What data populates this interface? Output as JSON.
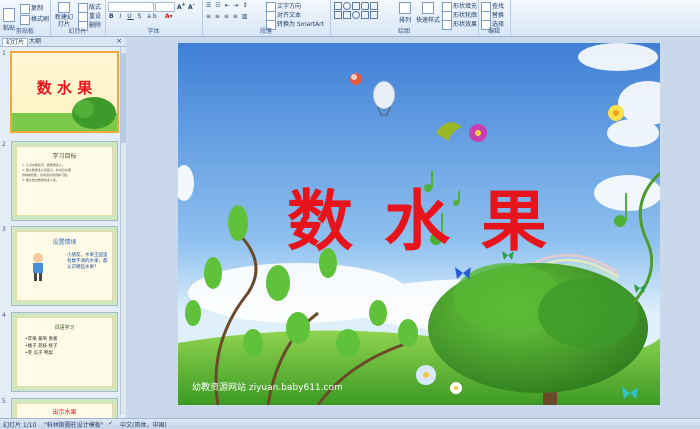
{
  "ribbon": {
    "groups": [
      {
        "label": "剪贴板",
        "buttons": [
          "粘贴",
          "复制",
          "格式刷"
        ]
      },
      {
        "label": "幻灯片",
        "buttons": [
          "新建幻灯片",
          "版式",
          "重设",
          "删除"
        ]
      },
      {
        "label": "字体",
        "buttons": []
      },
      {
        "label": "段落",
        "buttons": [
          "文字方向",
          "对齐文本",
          "转换为 SmartArt"
        ]
      },
      {
        "label": "绘图",
        "buttons": [
          "排列",
          "快速样式",
          "形状填充",
          "形状轮廓",
          "形状效果"
        ]
      },
      {
        "label": "编辑",
        "buttons": [
          "查找",
          "替换",
          "选择"
        ]
      }
    ]
  },
  "panel": {
    "tabs": [
      "幻灯片",
      "大纲"
    ],
    "thumbnails": [
      {
        "num": "1",
        "title": "数 水 果"
      },
      {
        "num": "2",
        "title": "学习目标",
        "lines": [
          "1. 认识水果名字，数数量多少。",
          "2. 能从数量多少来区分，并说出水果",
          "的种类和数，养成良好的观察习惯。",
          "3. 能比较出数量的多少来。"
        ]
      },
      {
        "num": "3",
        "title": "设置情境",
        "text": "小朋友，水果王国里有数不清的水果，都认识哪些水果？"
      },
      {
        "num": "4",
        "title": "词语学习",
        "lines": [
          "•苹果  葡萄  香蕉",
          "•橘子  荔枝  桃子",
          "•枣   瓜子  鸭梨"
        ]
      },
      {
        "num": "5",
        "title": "出示水果"
      }
    ]
  },
  "slide": {
    "title": "数 水 果",
    "watermark": "幼教资源网站 ziyuan.baby611.com"
  },
  "status": {
    "slide_info": "幻灯片 1/10",
    "theme": "\"科林斯圆柱设计模板\"",
    "language": "中文(简体，中国)"
  },
  "colors": {
    "title_red": "#e8141b",
    "sky_top": "#3f7fd6",
    "grass": "#55b82f",
    "ribbon_bg": "#dbe6f4",
    "selected_border": "#f2a93b"
  }
}
